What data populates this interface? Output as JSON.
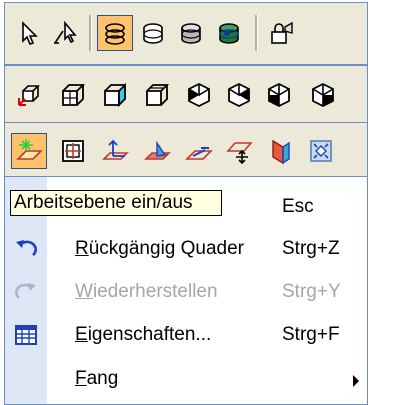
{
  "toolbar_row1": [
    {
      "name": "select-arrow-icon",
      "active": false
    },
    {
      "name": "select-edit-arrow-icon",
      "active": false
    },
    {
      "name": "render-wireframe-icon",
      "active": true
    },
    {
      "name": "render-hidden-icon",
      "active": false
    },
    {
      "name": "render-shaded-icon",
      "active": false
    },
    {
      "name": "render-texture-icon",
      "active": false
    },
    {
      "name": "camera-lock-icon",
      "active": false
    }
  ],
  "toolbar_row2": [
    {
      "name": "view-3d-axes-icon"
    },
    {
      "name": "view-front-icon"
    },
    {
      "name": "view-right-icon"
    },
    {
      "name": "view-top-icon"
    },
    {
      "name": "view-iso-1-icon"
    },
    {
      "name": "view-iso-2-icon"
    },
    {
      "name": "view-iso-3-icon"
    },
    {
      "name": "view-iso-4-icon"
    }
  ],
  "toolbar_row3": [
    {
      "name": "work-plane-toggle-icon",
      "active": true
    },
    {
      "name": "plane-grid-icon"
    },
    {
      "name": "plane-axes-icon"
    },
    {
      "name": "plane-shaded-icon"
    },
    {
      "name": "plane-edit-icon"
    },
    {
      "name": "plane-move-icon"
    },
    {
      "name": "plane-section-icon"
    },
    {
      "name": "zoom-extents-icon"
    }
  ],
  "tooltip": "Arbeitsebene ein/aus",
  "menu": {
    "items": [
      {
        "label_pre": "",
        "label_ul": "",
        "label_post": "",
        "shortcut": "Esc",
        "icon": "",
        "disabled": false,
        "submenu": false
      },
      {
        "label_pre": "",
        "label_ul": "R",
        "label_post": "ückgängig Quader",
        "shortcut": "Strg+Z",
        "icon": "undo-icon",
        "disabled": false,
        "submenu": false
      },
      {
        "label_pre": "",
        "label_ul": "W",
        "label_post": "iederherstellen",
        "shortcut": "Strg+Y",
        "icon": "redo-icon",
        "disabled": true,
        "submenu": false
      },
      {
        "label_pre": "",
        "label_ul": "E",
        "label_post": "igenschaften...",
        "shortcut": "Strg+F",
        "icon": "properties-icon",
        "disabled": false,
        "submenu": false
      },
      {
        "label_pre": "",
        "label_ul": "F",
        "label_post": "ang",
        "shortcut": "",
        "icon": "",
        "disabled": false,
        "submenu": true
      }
    ]
  },
  "colors": {
    "accent": "#ffc46b",
    "menu_stripe": "#dde7f6",
    "border": "#6a8fc7",
    "disabled": "#a7a6a0",
    "tooltip_bg": "#ffffe1"
  }
}
